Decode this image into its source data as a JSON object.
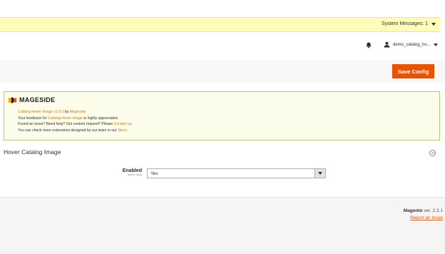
{
  "system_messages": {
    "label": "System Messages: 1"
  },
  "user": {
    "name": "demo_catalog_ho..."
  },
  "toolbar": {
    "save_label": "Save Config"
  },
  "promo": {
    "brand": "MAGESIDE",
    "line1_product": "Catalog Hover Image v1.0.0",
    "line1_by": " by ",
    "line1_vendor": "Mageside",
    "line2_pre": "Your feedback for ",
    "line2_link": "Catalog Hover Image",
    "line2_post": " is highly appreciated.",
    "line3_pre": "Found an issue? Need help? Got custom request? Please ",
    "line3_link": "Contact us",
    "line3_post": ".",
    "line4_pre": "You can check more extensions designed by our team in our ",
    "line4_link": "Store",
    "line4_post": "."
  },
  "section": {
    "title": "Hover Catalog Image"
  },
  "field": {
    "label": "Enabled",
    "scope": "[store view]",
    "value": "Yes"
  },
  "footer": {
    "brand": "Magento",
    "version": " ver. 2.2.1",
    "report": "Report an Issue"
  },
  "colors": {
    "accent": "#eb5202",
    "sysbar": "#fffbbb",
    "promo_bg": "#fbfcea"
  }
}
